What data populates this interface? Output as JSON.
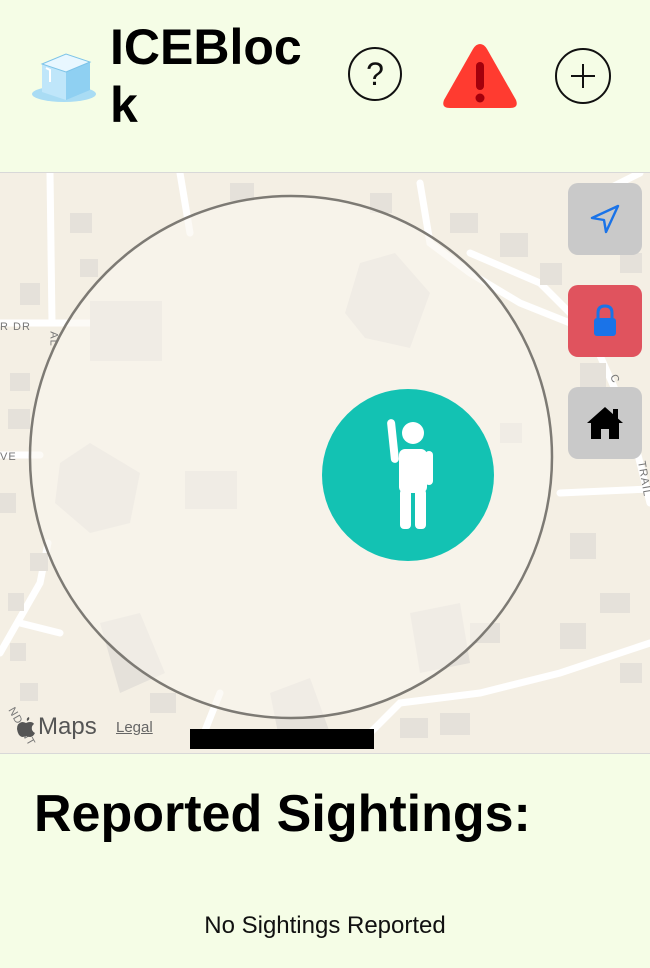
{
  "header": {
    "app_title": "ICEBlock",
    "help_label": "?",
    "icons": {
      "logo": "ice-cube-icon",
      "help": "question-circle-icon",
      "report": "warning-triangle-icon",
      "add": "plus-circle-icon"
    },
    "colors": {
      "warning": "#ff3b30"
    }
  },
  "map": {
    "attribution_brand": "Maps",
    "legal_link": "Legal",
    "street_labels": [
      "R DR",
      "AL",
      "VE",
      "TRAIL",
      "C",
      "NDENT"
    ],
    "buttons": {
      "locate_icon": "location-arrow-icon",
      "lock_icon": "lock-icon",
      "home_icon": "home-icon"
    },
    "marker_icon": "person-waving-icon",
    "colors": {
      "marker": "#13c2b3",
      "lock_button": "#e0535e",
      "locate_arrow": "#1a73e8"
    }
  },
  "sightings": {
    "heading": "Reported Sightings:",
    "empty_message": "No Sightings Reported"
  }
}
